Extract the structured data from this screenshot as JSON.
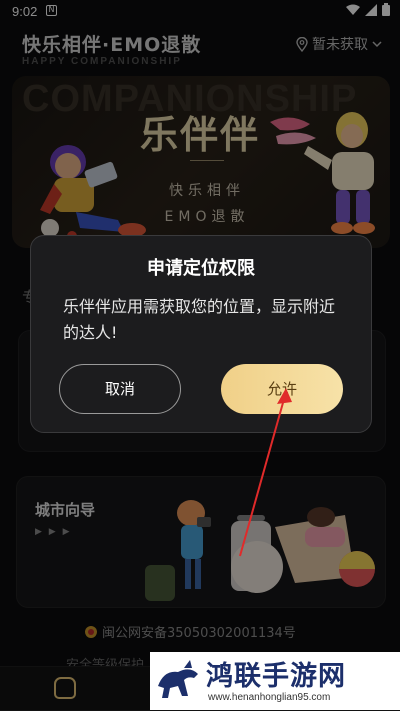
{
  "status_bar": {
    "time": "9:02",
    "notif": "N"
  },
  "header": {
    "brand": "快乐相伴·EMO退散",
    "brand_sub": "HAPPY COMPANIONSHIP",
    "location": "暂未获取"
  },
  "banner": {
    "bg_word": "COMPANIONSHIP",
    "title": "乐伴伴",
    "line1": "快乐相伴",
    "line2": "EMO退散"
  },
  "behind": {
    "section_fragment": "专"
  },
  "city_card": {
    "title": "城市向导",
    "dots": "▶ ▶ ▶"
  },
  "footer": {
    "icp": "闽公网安备35050302001134号",
    "icp2": "安全等级保护"
  },
  "dialog": {
    "title": "申请定位权限",
    "message": "乐伴伴应用需获取您的位置，显示附近的达人!",
    "cancel": "取消",
    "allow": "允许"
  },
  "watermark": {
    "text": "鸿联手游网",
    "url": "www.henanhonglian95.com"
  },
  "colors": {
    "accent_gold": "#f0d088",
    "arrow": "#e02a2a",
    "watermark_blue": "#1c2f6b"
  }
}
